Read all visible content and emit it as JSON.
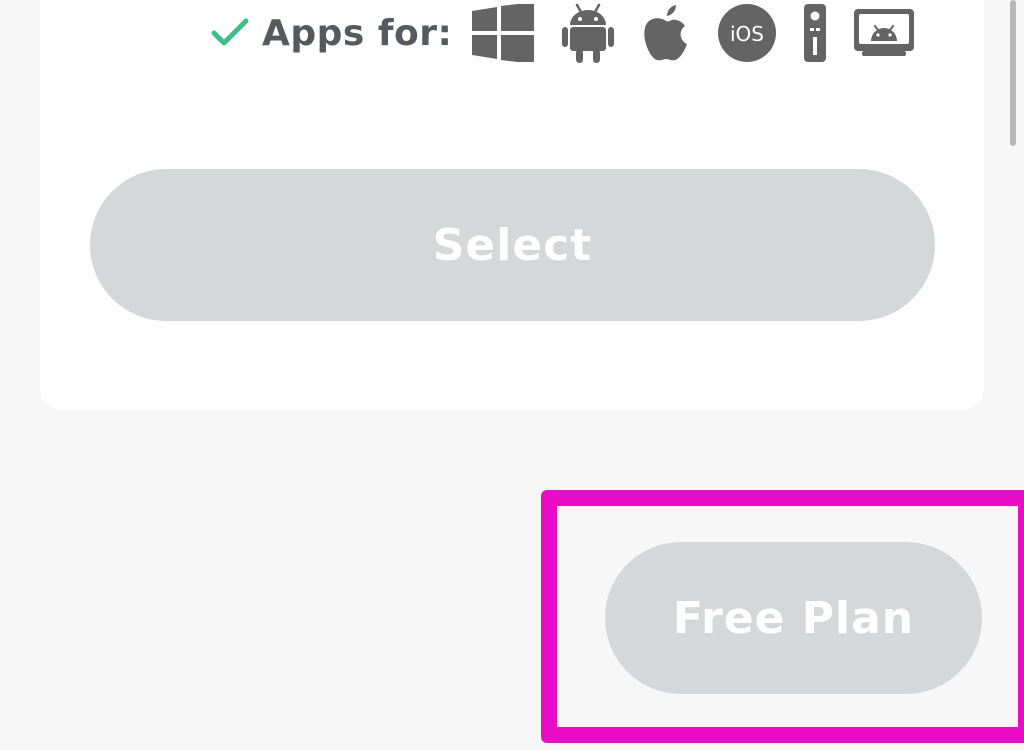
{
  "plan_card": {
    "apps_label": "Apps for:",
    "platform_icons": [
      "windows-icon",
      "android-icon",
      "apple-icon",
      "ios-icon",
      "fire-tv-remote-icon",
      "android-tv-icon"
    ],
    "ios_icon_text": "iOS",
    "select_label": "Select"
  },
  "free_plan": {
    "label": "Free Plan"
  },
  "colors": {
    "check": "#3fbf86",
    "icon": "#646464",
    "button_bg": "#d6d7d8",
    "button_text": "#ffffff",
    "highlight": "#e80bc8"
  }
}
